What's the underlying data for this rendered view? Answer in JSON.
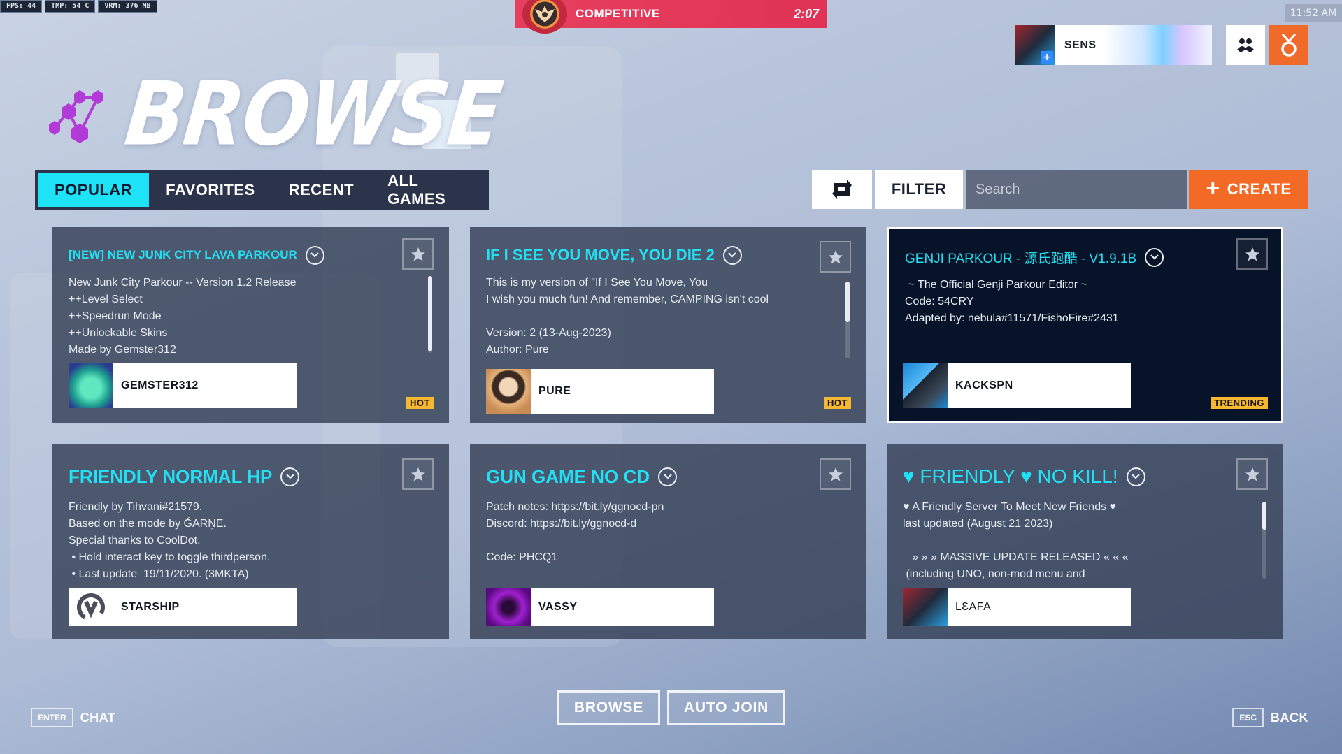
{
  "hud": {
    "fps": "FPS: 44",
    "temp": "TMP: 54 C",
    "vram": "VRM: 376 MB",
    "clock": "11:52 AM"
  },
  "competitive": {
    "label": "COMPETITIVE",
    "timer": "2:07"
  },
  "profile": {
    "name": "SENS"
  },
  "page": {
    "title": "BROWSE"
  },
  "tabs": [
    {
      "label": "POPULAR",
      "active": true
    },
    {
      "label": "FAVORITES",
      "active": false
    },
    {
      "label": "RECENT",
      "active": false
    },
    {
      "label": "ALL GAMES",
      "active": false
    }
  ],
  "toolbar": {
    "filter": "FILTER",
    "search_placeholder": "Search",
    "create": "CREATE"
  },
  "cards": [
    {
      "title": "[NEW] NEW JUNK CITY LAVA PARKOUR",
      "desc": "New Junk City Parkour -- Version 1.2 Release\n++Level Select\n++Speedrun Mode\n++Unlockable Skins\nMade by Gemster312",
      "author": "GEMSTER312",
      "badge": "HOT"
    },
    {
      "title": "IF I SEE YOU MOVE, YOU DIE 2",
      "desc": "This is my version of \"If I See You Move, You\nI wish you much fun! And remember, CAMPING isn't cool\n\nVersion: 2 (13-Aug-2023)\nAuthor: Pure",
      "author": "PURE",
      "badge": "HOT"
    },
    {
      "title": "GENJI PARKOUR - 源氏跑酷 - V1.9.1B",
      "desc": " ~ The Official Genji Parkour Editor ~\nCode: 54CRY\nAdapted by: nebula#11571/FishoFire#2431",
      "author": "KACKSPN",
      "badge": "TRENDING"
    },
    {
      "title": "FRIENDLY NORMAL HP",
      "desc": "Friendly by Tihvani#21579.\nBased on the mode by ǴARŅE.\nSpecial thanks to CoolDot.\n • Hold interact key to toggle thirdperson.\n • Last update  19/11/2020. (3MKTA)",
      "author": "STARSHIP",
      "badge": ""
    },
    {
      "title": "GUN GAME NO CD",
      "desc": "Patch notes: https://bit.ly/ggnocd-pn\nDiscord: https://bit.ly/ggnocd-d\n\nCode: PHCQ1",
      "author": "VASSY",
      "badge": ""
    },
    {
      "title": "♥ FRIENDLY ♥ NO KILL!",
      "desc": "♥ A Friendly Server To Meet New Friends ♥\nlast updated (August 21 2023)\n\n   » » » MASSIVE UPDATE RELEASED « « «\n (including UNO, non-mod menu and",
      "author": "LƐAFA",
      "badge": ""
    }
  ],
  "bottom": {
    "enter_key": "ENTER",
    "chat": "CHAT",
    "browse": "BROWSE",
    "auto_join": "AUTO JOIN",
    "esc_key": "ESC",
    "back": "BACK"
  }
}
